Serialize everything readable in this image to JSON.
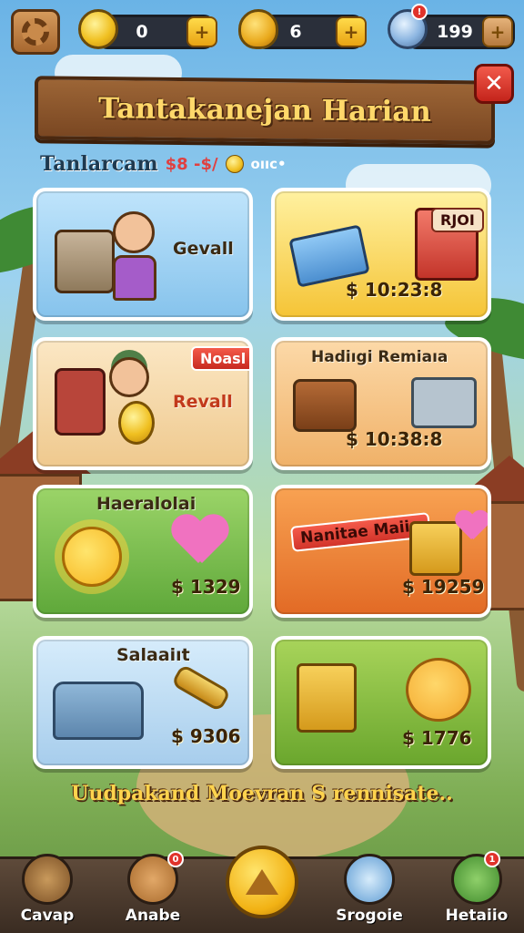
{
  "hud": {
    "coins": "0",
    "shells": "6",
    "gems": "199"
  },
  "banner": {
    "title": "Tantakanejan Harian",
    "close_label": "✕"
  },
  "subtitle": {
    "text": "Tanlarcam",
    "extra": "$8 -$/",
    "tail": "oııc•"
  },
  "cards": [
    {
      "name": "Gevall",
      "price": "",
      "tag": ""
    },
    {
      "name": "",
      "price": "$ 10:23:8",
      "tag": "RJOI"
    },
    {
      "name": "Revall",
      "price": "",
      "tag": "Noasl"
    },
    {
      "name": "Hadiıgi Remiaıa",
      "price": "$ 10:38:8",
      "tag": ""
    },
    {
      "name": "Haeralolai",
      "price": "$ 1329",
      "tag": ""
    },
    {
      "name": "Nanitae Maiin",
      "price": "$ 19259",
      "tag": ""
    },
    {
      "name": "Salaaiıt",
      "price": "$ 9306",
      "tag": ""
    },
    {
      "name": "",
      "price": "$ 1776",
      "tag": ""
    }
  ],
  "footer": {
    "message": "Uudpakand Moevran S rennisate.."
  },
  "nav": {
    "items": [
      {
        "label": "Cavap",
        "icon": "magnifier-icon"
      },
      {
        "label": "Anabe",
        "icon": "cookie-icon"
      },
      {
        "label": "",
        "icon": "home-icon"
      },
      {
        "label": "Srogoie",
        "icon": "bucket-icon"
      },
      {
        "label": "Hetaiio",
        "icon": "sword-icon"
      }
    ],
    "badges": {
      "anabe": "0",
      "hetaiio": "1"
    }
  },
  "colors": {
    "banner_text": "#ffd86a",
    "price_text": "#3a2307",
    "accent_gold": "#f0c021",
    "close_red": "#e0332b"
  }
}
